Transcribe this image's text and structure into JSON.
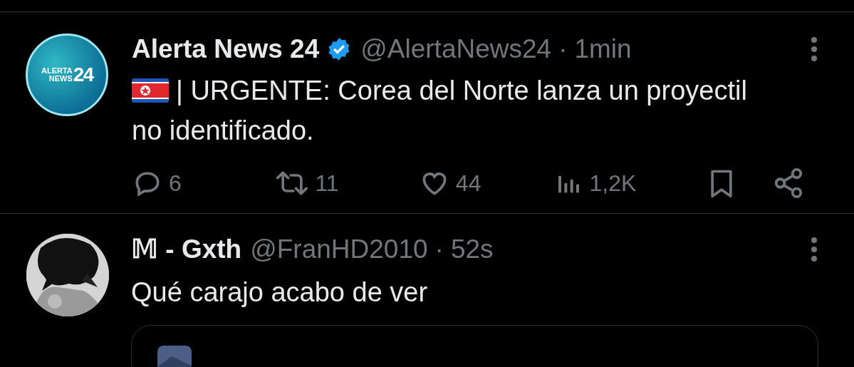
{
  "tweets": [
    {
      "kind": "post",
      "avatar_text": [
        "ALERTA",
        "NEWS",
        "24"
      ],
      "name": "Alerta News 24",
      "verified": true,
      "handle": "@AlertaNews24",
      "separator": "·",
      "time": "1min",
      "flag": true,
      "text": "| URGENTE: Corea del Norte lanza un proyectil no identificado.",
      "actions": [
        {
          "kind": "reply",
          "count": "6"
        },
        {
          "kind": "repost",
          "count": "11"
        },
        {
          "kind": "like",
          "count": "44"
        },
        {
          "kind": "views",
          "count": "1,2K"
        },
        {
          "kind": "bookmark"
        },
        {
          "kind": "share"
        }
      ]
    },
    {
      "kind": "reply",
      "name": "𝕄 - Gxth",
      "handle": "@FranHD2010",
      "separator": "·",
      "time": "52s",
      "text": "Qué carajo acabo de ver",
      "quote": true
    }
  ]
}
